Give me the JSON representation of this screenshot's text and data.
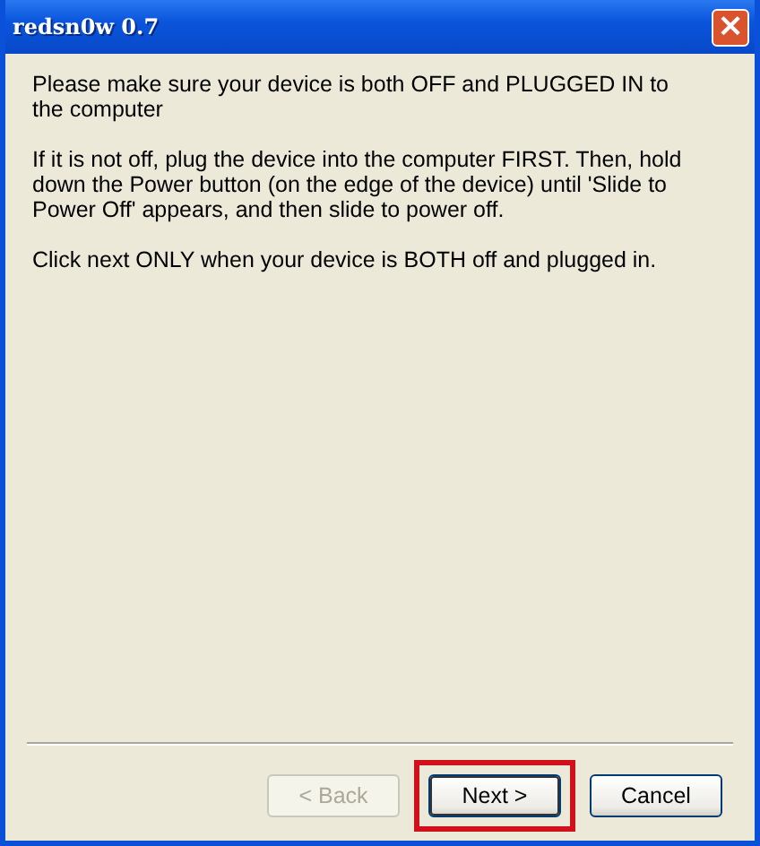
{
  "window": {
    "title": "redsn0w 0.7",
    "close": "×"
  },
  "paragraphs": [
    "Please make sure your device is both OFF and PLUGGED IN to the computer",
    "If it is not off, plug the device into the computer FIRST. Then, hold down the Power button (on the edge of the device) until 'Slide to Power Off' appears, and then slide to power off.",
    "Click next ONLY when your device is BOTH off and plugged in."
  ],
  "buttons": [
    {
      "label": "< Back",
      "disabled": true,
      "default": false,
      "highlighted": false
    },
    {
      "label": "Next >",
      "disabled": false,
      "default": true,
      "highlighted": true
    },
    {
      "label": "Cancel",
      "disabled": false,
      "default": false,
      "highlighted": false
    }
  ]
}
